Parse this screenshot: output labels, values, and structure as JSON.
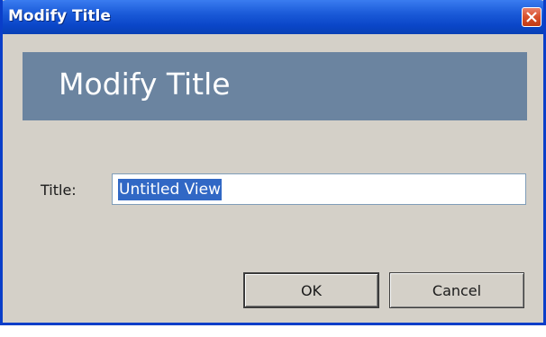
{
  "window": {
    "title": "Modify Title"
  },
  "banner": {
    "heading": "Modify Title"
  },
  "form": {
    "title_label": "Title:",
    "title_value": "Untitled View"
  },
  "buttons": {
    "ok_label": "OK",
    "cancel_label": "Cancel"
  },
  "colors": {
    "titlebar": "#0a46c8",
    "banner": "#6b84a0",
    "dialog_bg": "#d4d0c8",
    "selection": "#3168c5",
    "close_button": "#d8502a"
  },
  "icons": {
    "close": "close-icon"
  }
}
